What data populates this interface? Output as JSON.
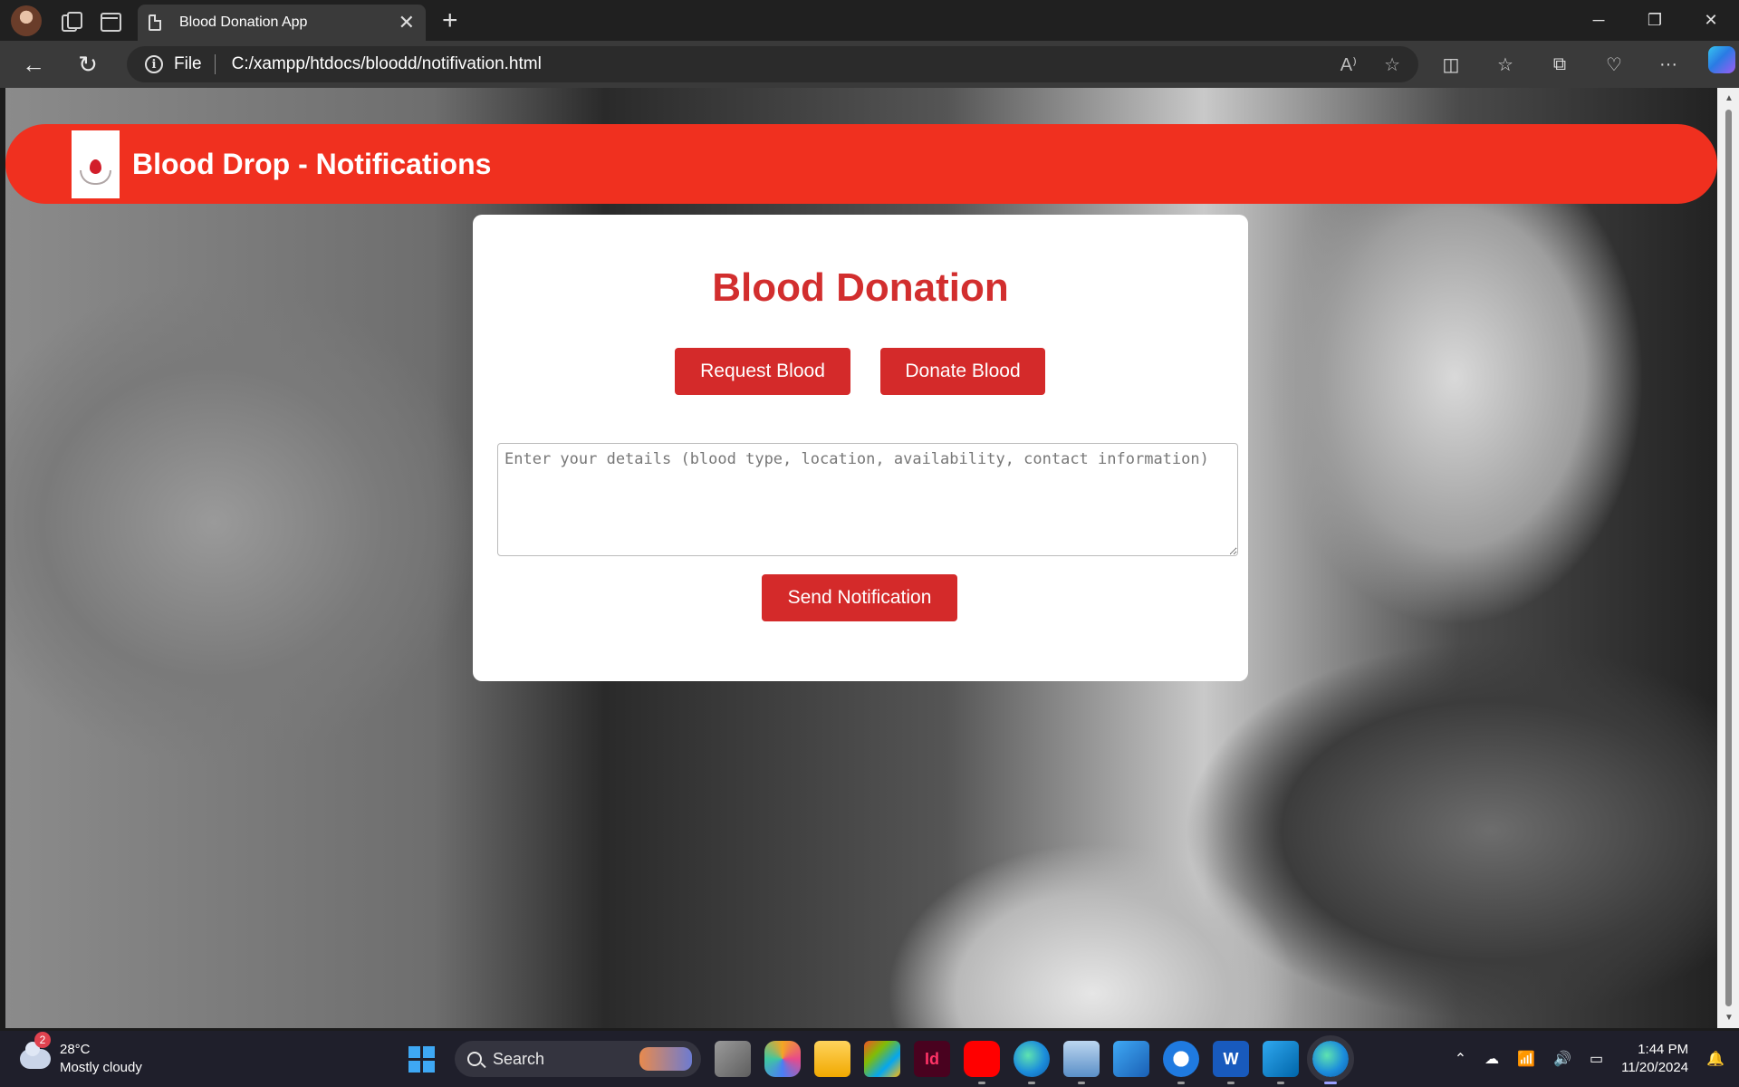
{
  "browser": {
    "tab_title": "Blood Donation App",
    "tab_close": "✕",
    "new_tab": "+",
    "address_scheme": "File",
    "address_url": "C:/xampp/htdocs/bloodd/notifivation.html",
    "window_controls": [
      "─",
      "❐",
      "✕"
    ]
  },
  "app": {
    "header_title": "Blood Drop - Notifications",
    "card_title": "Blood Donation",
    "request_button": "Request Blood",
    "donate_button": "Donate Blood",
    "details_placeholder": "Enter your details (blood type, location, availability, contact information)",
    "send_button": "Send Notification",
    "brand_color": "#f0301f",
    "button_color": "#d42a2a"
  },
  "taskbar": {
    "weather_badge": "2",
    "temperature": "28°C",
    "weather_desc": "Mostly cloudy",
    "search_label": "Search",
    "time": "1:44 PM",
    "date": "11/20/2024"
  }
}
